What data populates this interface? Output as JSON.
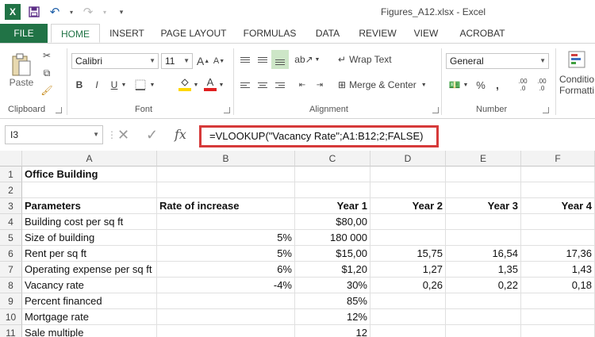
{
  "window": {
    "title": "Figures_A12.xlsx - Excel"
  },
  "quick_access": {
    "app_icon": "X",
    "icons": [
      "save-icon",
      "undo-icon",
      "redo-icon",
      "customize-icon"
    ]
  },
  "tabs": [
    "FILE",
    "HOME",
    "INSERT",
    "PAGE LAYOUT",
    "FORMULAS",
    "DATA",
    "REVIEW",
    "VIEW",
    "ACROBAT"
  ],
  "ribbon": {
    "clipboard": {
      "label": "Clipboard",
      "paste_label": "Paste"
    },
    "font": {
      "label": "Font",
      "name": "Calibri",
      "size": "11",
      "grow": "A",
      "shrink": "A",
      "bold": "B",
      "italic": "I",
      "underline": "U",
      "font_color": "A"
    },
    "alignment": {
      "label": "Alignment",
      "wrap_text": "Wrap Text",
      "merge_center": "Merge & Center"
    },
    "number": {
      "label": "Number",
      "format": "General",
      "percent": "%",
      "comma": ",",
      "inc_decimal": ".00",
      "dec_decimal": ".00"
    },
    "styles": {
      "conditional": "Conditio",
      "formatting": "Formatti"
    }
  },
  "formula_bar": {
    "name_box": "I3",
    "cancel": "✕",
    "enter": "✓",
    "fx": "fx",
    "formula": "=VLOOKUP(\"Vacancy Rate\";A1:B12;2;FALSE)"
  },
  "columns": [
    "A",
    "B",
    "C",
    "D",
    "E",
    "F"
  ],
  "rows": [
    {
      "num": "1",
      "cells": [
        "Office Building",
        "",
        "",
        "",
        "",
        ""
      ]
    },
    {
      "num": "2",
      "cells": [
        "",
        "",
        "",
        "",
        "",
        ""
      ]
    },
    {
      "num": "3",
      "cells": [
        "Parameters",
        "Rate of increase",
        "Year 1",
        "Year 2",
        "Year 3",
        "Year 4"
      ]
    },
    {
      "num": "4",
      "cells": [
        "Building cost per sq ft",
        "",
        "$80,00",
        "",
        "",
        ""
      ]
    },
    {
      "num": "5",
      "cells": [
        "Size of building",
        "5%",
        "180 000",
        "",
        "",
        ""
      ]
    },
    {
      "num": "6",
      "cells": [
        "Rent per sq ft",
        "5%",
        "$15,00",
        "15,75",
        "16,54",
        "17,36"
      ]
    },
    {
      "num": "7",
      "cells": [
        "Operating expense per sq ft",
        "6%",
        "$1,20",
        "1,27",
        "1,35",
        "1,43"
      ]
    },
    {
      "num": "8",
      "cells": [
        "Vacancy rate",
        "-4%",
        "30%",
        "0,26",
        "0,22",
        "0,18"
      ]
    },
    {
      "num": "9",
      "cells": [
        "Percent financed",
        "",
        "85%",
        "",
        "",
        ""
      ]
    },
    {
      "num": "10",
      "cells": [
        "Mortgage rate",
        "",
        "12%",
        "",
        "",
        ""
      ]
    },
    {
      "num": "11",
      "cells": [
        "Sale multiple",
        "",
        "12",
        "",
        "",
        ""
      ]
    }
  ],
  "colors": {
    "excel_green": "#217346",
    "highlight_border": "#d63a3a",
    "fill_yellow": "#ffd700",
    "font_red": "#e02020"
  }
}
